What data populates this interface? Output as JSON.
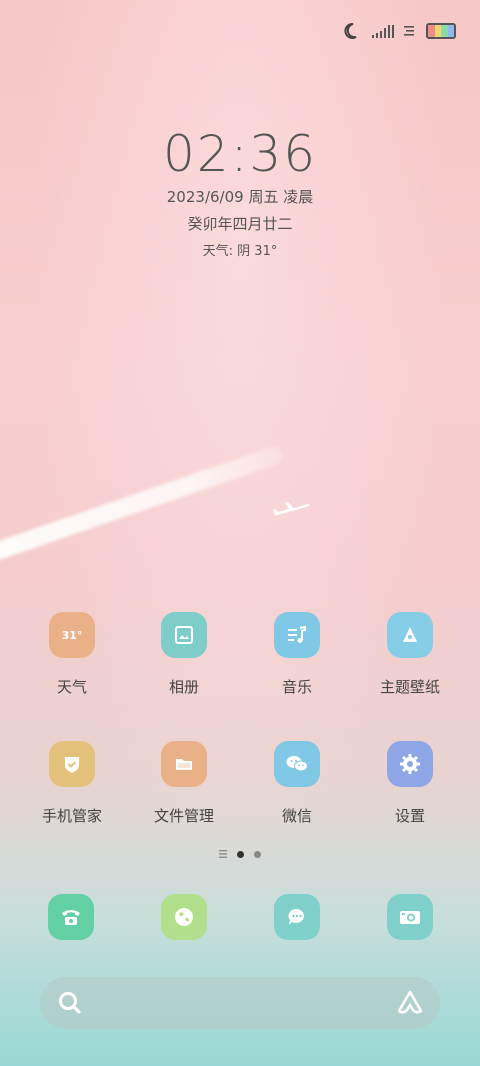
{
  "status_bar": {
    "icons": [
      "moon-icon",
      "signal-icon",
      "wifi-icon",
      "battery-icon"
    ]
  },
  "lockscreen": {
    "time": "02:36",
    "date": "2023/6/09 周五 凌晨",
    "lunar": "癸卯年四月廿二",
    "weather": "天气: 阴 31°"
  },
  "apps": [
    {
      "label": "天气",
      "icon": "weather-icon",
      "badge": "31°",
      "color": "#eab189"
    },
    {
      "label": "相册",
      "icon": "gallery-icon",
      "color": "#7fcdc9"
    },
    {
      "label": "音乐",
      "icon": "music-icon",
      "color": "#7fc8e6"
    },
    {
      "label": "主题壁纸",
      "icon": "theme-icon",
      "color": "#86cde8"
    },
    {
      "label": "手机管家",
      "icon": "security-icon",
      "color": "#e5c27c"
    },
    {
      "label": "文件管理",
      "icon": "folder-icon",
      "color": "#eab189"
    },
    {
      "label": "微信",
      "icon": "wechat-icon",
      "color": "#7fc8e6"
    },
    {
      "label": "设置",
      "icon": "settings-icon",
      "color": "#8ea5e6"
    }
  ],
  "pager": {
    "active": 1,
    "count": 2
  },
  "dock": [
    {
      "icon": "phone-icon",
      "color": "#63cfa4"
    },
    {
      "icon": "browser-icon",
      "color": "#b1df8c"
    },
    {
      "icon": "messages-icon",
      "color": "#7fd0cb"
    },
    {
      "icon": "camera-icon",
      "color": "#7fd0cb"
    }
  ],
  "search": {
    "left_icon": "search-icon",
    "right_icon": "assistant-icon"
  }
}
